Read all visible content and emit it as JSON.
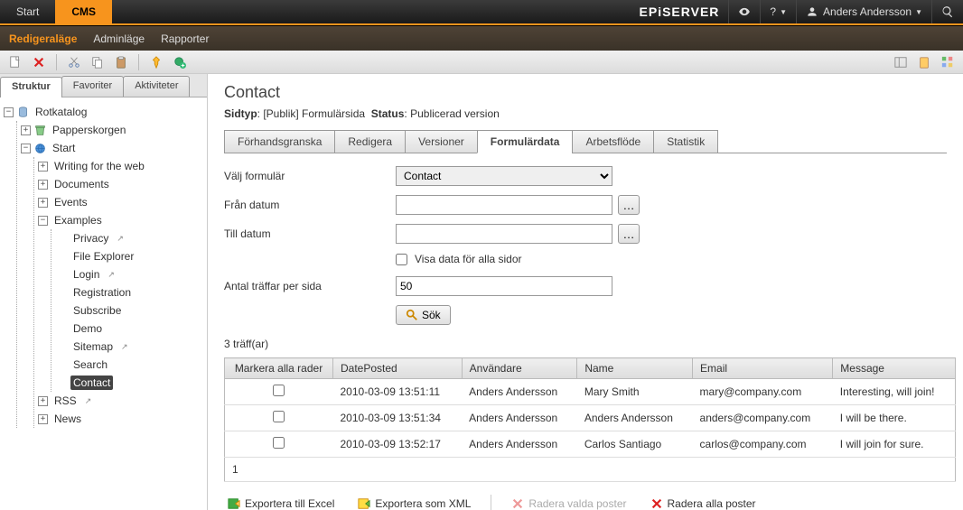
{
  "topbar": {
    "tabs": [
      {
        "label": "Start"
      },
      {
        "label": "CMS"
      }
    ],
    "brand": "EPiSERVER",
    "help": "?",
    "user": "Anders Andersson"
  },
  "menubar": {
    "items": [
      {
        "label": "Redigeraläge",
        "active": true
      },
      {
        "label": "Adminläge"
      },
      {
        "label": "Rapporter"
      }
    ]
  },
  "sidebar": {
    "tabs": [
      {
        "label": "Struktur",
        "active": true
      },
      {
        "label": "Favoriter"
      },
      {
        "label": "Aktiviteter"
      }
    ],
    "root": "Rotkatalog",
    "trash": "Papperskorgen",
    "start": "Start",
    "nodes": {
      "writing": "Writing for the web",
      "documents": "Documents",
      "events": "Events",
      "examples": "Examples",
      "privacy": "Privacy",
      "file_explorer": "File Explorer",
      "login": "Login",
      "registration": "Registration",
      "subscribe": "Subscribe",
      "demo": "Demo",
      "sitemap": "Sitemap",
      "search": "Search",
      "contact": "Contact",
      "rss": "RSS",
      "news": "News"
    }
  },
  "content": {
    "title": "Contact",
    "meta": {
      "sidtyp_label": "Sidtyp",
      "sidtyp_value": "[Publik] Formulärsida",
      "status_label": "Status",
      "status_value": "Publicerad version"
    },
    "tabs": [
      {
        "label": "Förhandsgranska"
      },
      {
        "label": "Redigera"
      },
      {
        "label": "Versioner"
      },
      {
        "label": "Formulärdata",
        "active": true
      },
      {
        "label": "Arbetsflöde"
      },
      {
        "label": "Statistik"
      }
    ],
    "form": {
      "valj_formular_label": "Välj formulär",
      "valj_formular_value": "Contact",
      "fran_datum_label": "Från datum",
      "fran_datum_value": "",
      "till_datum_label": "Till datum",
      "till_datum_value": "",
      "visa_alla_label": "Visa data för alla sidor",
      "antal_label": "Antal träffar per sida",
      "antal_value": "50",
      "sok_label": "Sök"
    },
    "hits": "3 träff(ar)",
    "table": {
      "headers": {
        "mark": "Markera alla rader",
        "date": "DatePosted",
        "user": "Användare",
        "name": "Name",
        "email": "Email",
        "msg": "Message"
      },
      "rows": [
        {
          "date": "2010-03-09 13:51:11",
          "user": "Anders Andersson",
          "name": "Mary Smith",
          "email": "mary@company.com",
          "msg": "Interesting, will join!"
        },
        {
          "date": "2010-03-09 13:51:34",
          "user": "Anders Andersson",
          "name": "Anders Andersson",
          "email": "anders@company.com",
          "msg": "I will be there."
        },
        {
          "date": "2010-03-09 13:52:17",
          "user": "Anders Andersson",
          "name": "Carlos Santiago",
          "email": "carlos@company.com",
          "msg": "I will join for sure."
        }
      ],
      "page": "1"
    },
    "actions": {
      "export_excel": "Exportera till Excel",
      "export_xml": "Exportera som XML",
      "delete_selected": "Radera valda poster",
      "delete_all": "Radera alla poster"
    }
  }
}
